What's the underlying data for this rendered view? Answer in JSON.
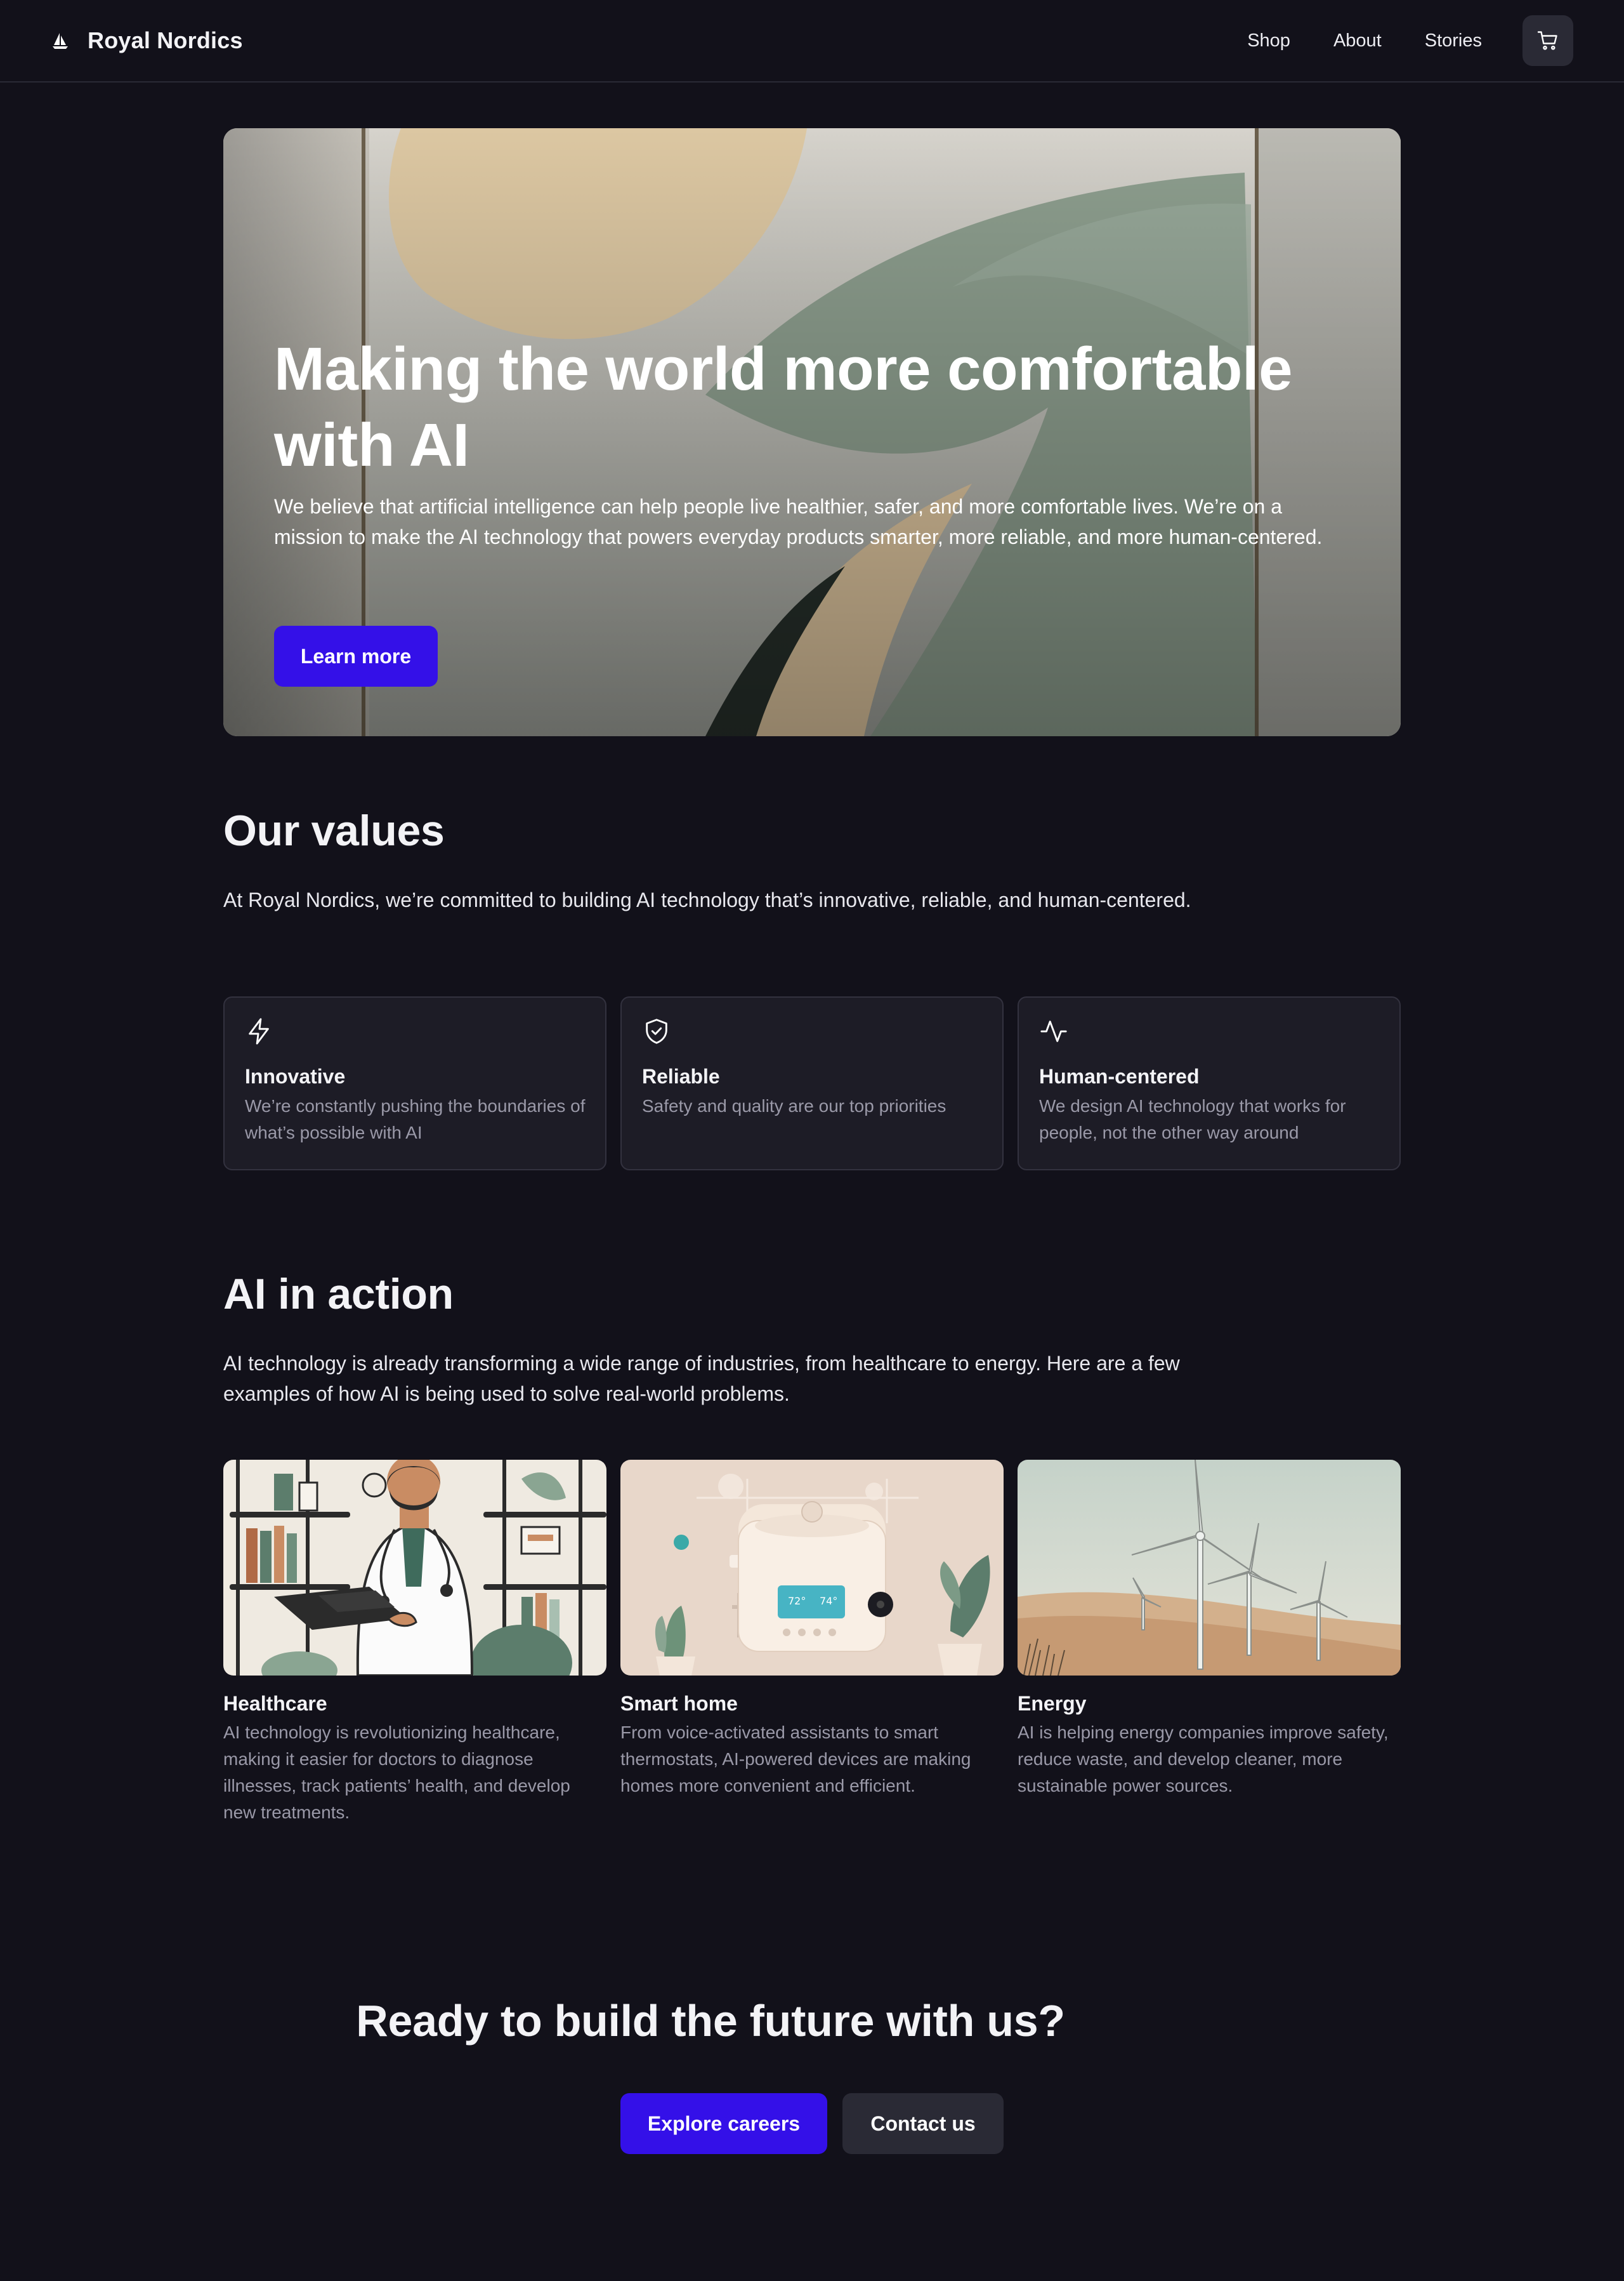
{
  "brand": {
    "name": "Royal Nordics",
    "logo_icon": "sailboat-icon"
  },
  "nav": {
    "links": [
      "Shop",
      "About",
      "Stories"
    ],
    "cart_icon": "cart-icon"
  },
  "hero": {
    "title": "Making the world more comfortable with AI",
    "description": "We believe that artificial intelligence can help people live healthier, safer, and more comfortable lives. We’re on a mission to make the AI technology that powers everyday products smarter, more reliable, and more human-centered.",
    "button": "Learn more"
  },
  "values": {
    "title": "Our values",
    "description": "At Royal Nordics, we’re committed to building AI technology that’s innovative, reliable, and human-centered.",
    "items": [
      {
        "icon": "lightning-icon",
        "name": "Innovative",
        "text": "We’re constantly pushing the boundaries of what’s possible with AI"
      },
      {
        "icon": "shield-check-icon",
        "name": "Reliable",
        "text": "Safety and quality are our top priorities"
      },
      {
        "icon": "pulse-icon",
        "name": "Human-centered",
        "text": "We design AI technology that works for people, not the other way around"
      }
    ]
  },
  "action": {
    "title": "AI in action",
    "description": "AI technology is already transforming a wide range of industries, from healthcare to energy. Here are a few examples of how AI is being used to solve real-world problems.",
    "items": [
      {
        "name": "Healthcare",
        "text": "AI technology is revolutionizing healthcare, making it easier for doctors to diagnose illnesses, track patients’ health, and develop new treatments.",
        "thermostat": null
      },
      {
        "name": "Smart home",
        "text": "From voice-activated assistants to smart thermostats, AI-powered devices are making homes more convenient and efficient.",
        "thermostat": {
          "left": "72°",
          "right": "74°"
        }
      },
      {
        "name": "Energy",
        "text": "AI is helping energy companies improve safety, reduce waste, and develop cleaner, more sustainable power sources.",
        "thermostat": null
      }
    ]
  },
  "cta": {
    "title": "Ready to build the future with us?",
    "primary": "Explore careers",
    "secondary": "Contact us"
  },
  "colors": {
    "background": "#12111a",
    "accent": "#3410e8",
    "card": "#1d1c26",
    "muted_text": "#9a99a8"
  }
}
